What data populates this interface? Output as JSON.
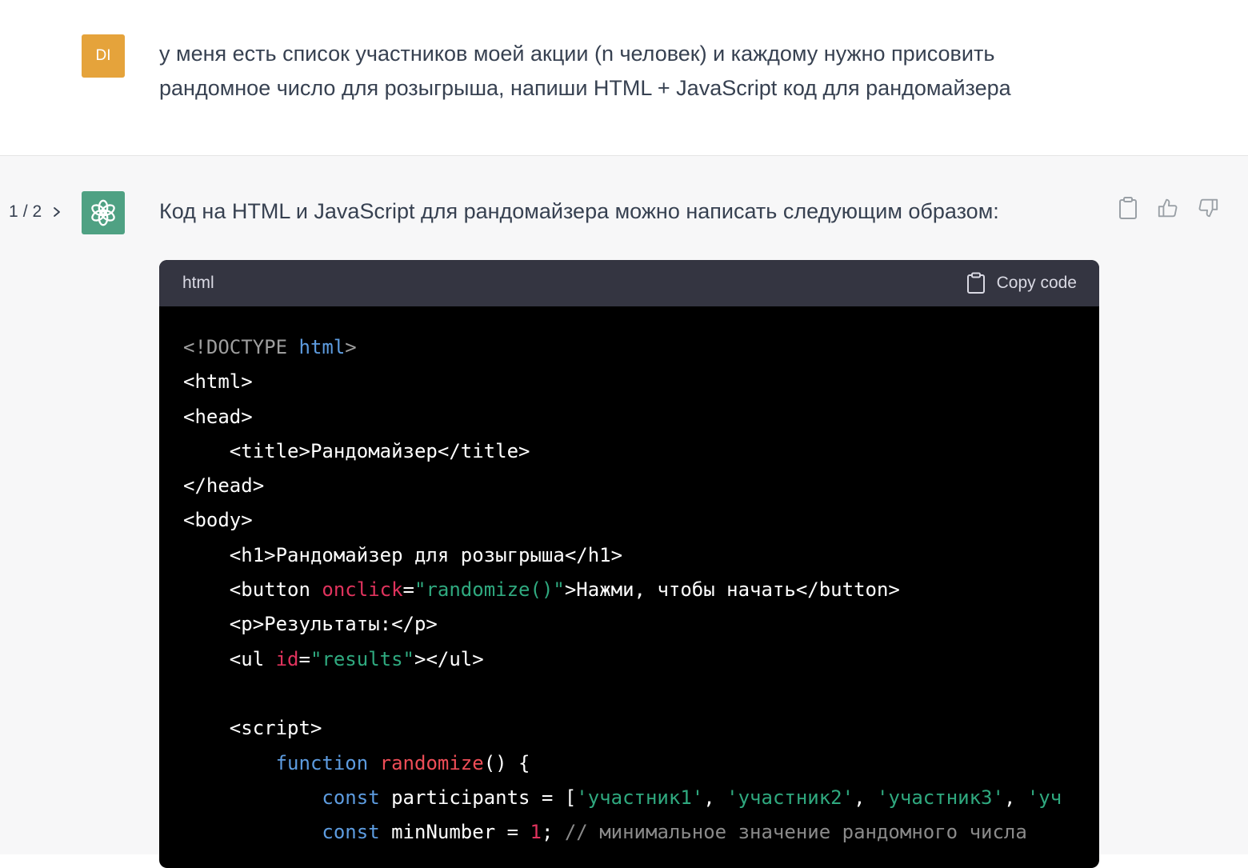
{
  "colors": {
    "user_avatar_bg": "#e5a33b",
    "bot_avatar_bg": "#4fa183",
    "conversation_bg": "#f7f7f8",
    "code_header_bg": "#343541",
    "code_bg": "#000000"
  },
  "user_message": {
    "avatar_initials": "DI",
    "text": "у меня есть список участников моей акции (n человек) и каждому нужно присовить рандомное число для розыгрыша, напиши HTML + JavaScript  код для рандомайзера"
  },
  "assistant_message": {
    "pager": {
      "current": "1",
      "separator": "/",
      "total": "2"
    },
    "avatar_icon": "openai-logo-icon",
    "intro_text": "Код на HTML и JavaScript для рандомайзера можно написать следующим образом:",
    "actions": [
      "copy-icon",
      "thumbs-up-icon",
      "thumbs-down-icon"
    ]
  },
  "code_block": {
    "language": "html",
    "copy_label": "Copy code",
    "lines": [
      {
        "indent": "",
        "tokens": [
          {
            "t": "<!DOCTYPE ",
            "c": "dim"
          },
          {
            "t": "html",
            "c": "blue"
          },
          {
            "t": ">",
            "c": "dim"
          }
        ]
      },
      {
        "indent": "",
        "tokens": [
          {
            "t": "<html>",
            "c": ""
          }
        ]
      },
      {
        "indent": "",
        "tokens": [
          {
            "t": "<head>",
            "c": ""
          }
        ]
      },
      {
        "indent": "    ",
        "tokens": [
          {
            "t": "<title>Рандомайзер</title>",
            "c": ""
          }
        ]
      },
      {
        "indent": "",
        "tokens": [
          {
            "t": "</head>",
            "c": ""
          }
        ]
      },
      {
        "indent": "",
        "tokens": [
          {
            "t": "<body>",
            "c": ""
          }
        ]
      },
      {
        "indent": "    ",
        "tokens": [
          {
            "t": "<h1>Рандомайзер для розыгрыша</h1>",
            "c": ""
          }
        ]
      },
      {
        "indent": "    ",
        "tokens": [
          {
            "t": "<button ",
            "c": ""
          },
          {
            "t": "onclick",
            "c": "attr"
          },
          {
            "t": "=",
            "c": ""
          },
          {
            "t": "\"randomize()\"",
            "c": "str"
          },
          {
            "t": ">Нажми, чтобы начать</button>",
            "c": ""
          }
        ]
      },
      {
        "indent": "    ",
        "tokens": [
          {
            "t": "<p>Результаты:</p>",
            "c": ""
          }
        ]
      },
      {
        "indent": "    ",
        "tokens": [
          {
            "t": "<ul ",
            "c": ""
          },
          {
            "t": "id",
            "c": "attr"
          },
          {
            "t": "=",
            "c": ""
          },
          {
            "t": "\"results\"",
            "c": "str"
          },
          {
            "t": "></ul>",
            "c": ""
          }
        ]
      },
      {
        "indent": "",
        "tokens": [
          {
            "t": "",
            "c": ""
          }
        ]
      },
      {
        "indent": "    ",
        "tokens": [
          {
            "t": "<script>",
            "c": ""
          }
        ]
      },
      {
        "indent": "        ",
        "tokens": [
          {
            "t": "function ",
            "c": "blue"
          },
          {
            "t": "randomize",
            "c": "fn"
          },
          {
            "t": "() {",
            "c": ""
          }
        ]
      },
      {
        "indent": "            ",
        "tokens": [
          {
            "t": "const ",
            "c": "blue"
          },
          {
            "t": "participants = [",
            "c": ""
          },
          {
            "t": "'участник1'",
            "c": "str"
          },
          {
            "t": ", ",
            "c": ""
          },
          {
            "t": "'участник2'",
            "c": "str"
          },
          {
            "t": ", ",
            "c": ""
          },
          {
            "t": "'участник3'",
            "c": "str"
          },
          {
            "t": ", ",
            "c": ""
          },
          {
            "t": "'уч",
            "c": "str"
          }
        ]
      },
      {
        "indent": "            ",
        "tokens": [
          {
            "t": "const ",
            "c": "blue"
          },
          {
            "t": "minNumber = ",
            "c": ""
          },
          {
            "t": "1",
            "c": "num"
          },
          {
            "t": "; ",
            "c": ""
          },
          {
            "t": "// минимальное значение рандомного числа",
            "c": "comment"
          }
        ]
      }
    ]
  }
}
